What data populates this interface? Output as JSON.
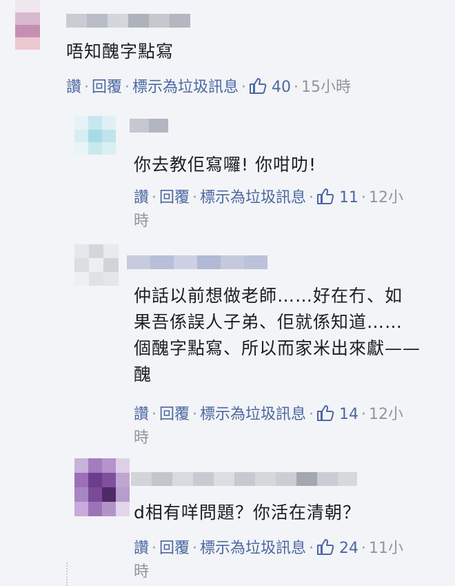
{
  "actions": {
    "like": "讚",
    "reply": "回覆",
    "spam": "標示為垃圾訊息",
    "sep": "·"
  },
  "comments": [
    {
      "text": "唔知醜字點寫",
      "likes": "40",
      "time": "15小時"
    },
    {
      "text": "你去教佢寫囉! 你咁叻!",
      "likes": "11",
      "time": "12小",
      "time_wrap": "時"
    },
    {
      "text": "仲話以前想做老師……好在冇、如\n果吾係誤人子弟、佢就係知道……\n個醜字點寫、所以而家米出來獻——\n醜",
      "likes": "14",
      "time": "12小",
      "time_wrap": "時"
    },
    {
      "text": "d相有咩問題？你活在清朝？",
      "likes": "24",
      "time": "11小",
      "time_wrap": "時"
    }
  ],
  "colors": {
    "link": "#4b67a1",
    "meta": "#90949c",
    "text": "#1c1e21",
    "background": "#f3f4f7"
  },
  "icons": {
    "like": "thumbs-up-icon"
  }
}
